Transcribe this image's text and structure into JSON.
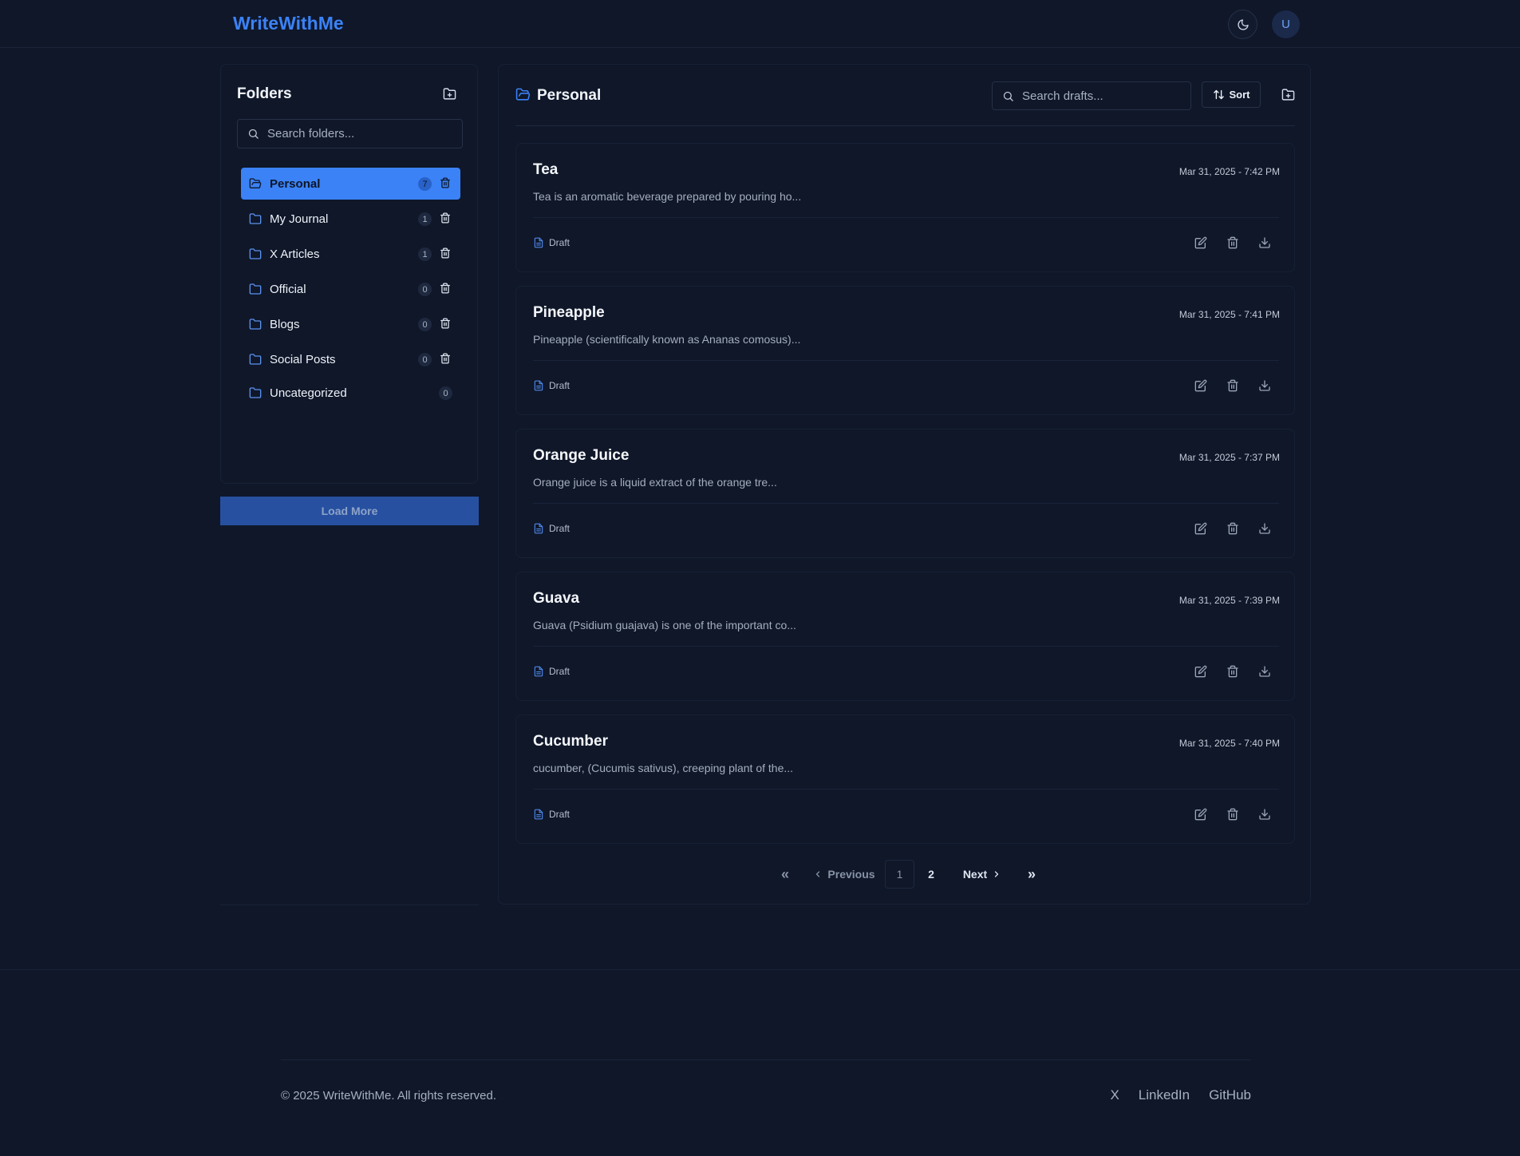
{
  "header": {
    "brand": "WriteWithMe",
    "avatar_initial": "U"
  },
  "sidebar": {
    "title": "Folders",
    "search_placeholder": "Search folders...",
    "folders": [
      {
        "name": "Personal",
        "count": "7",
        "active": true
      },
      {
        "name": "My Journal",
        "count": "1"
      },
      {
        "name": "X Articles",
        "count": "1"
      },
      {
        "name": "Official",
        "count": "0"
      },
      {
        "name": "Blogs",
        "count": "0"
      },
      {
        "name": "Social Posts",
        "count": "0"
      },
      {
        "name": "Uncategorized",
        "count": "0"
      }
    ],
    "load_more_label": "Load More"
  },
  "drafts": {
    "folder_title": "Personal",
    "search_placeholder": "Search drafts...",
    "sort_label": "Sort",
    "items": [
      {
        "title": "Tea",
        "date": "Mar 31, 2025 - 7:42 PM",
        "excerpt": "Tea is an aromatic beverage prepared by pouring ho...",
        "status": "Draft"
      },
      {
        "title": "Pineapple",
        "date": "Mar 31, 2025 - 7:41 PM",
        "excerpt": "Pineapple (scientifically known as Ananas comosus)...",
        "status": "Draft"
      },
      {
        "title": "Orange Juice",
        "date": "Mar 31, 2025 - 7:37 PM",
        "excerpt": "Orange juice is a liquid extract of the orange tre...",
        "status": "Draft"
      },
      {
        "title": "Guava",
        "date": "Mar 31, 2025 - 7:39 PM",
        "excerpt": "Guava (Psidium guajava) is one of the important co...",
        "status": "Draft"
      },
      {
        "title": "Cucumber",
        "date": "Mar 31, 2025 - 7:40 PM",
        "excerpt": "cucumber, (Cucumis sativus), creeping plant of the...",
        "status": "Draft"
      }
    ],
    "pagination": {
      "first": "«",
      "previous": "Previous",
      "pages": [
        "1",
        "2"
      ],
      "current_page": "1",
      "next": "Next",
      "last": "»"
    }
  },
  "footer": {
    "copyright": "© 2025 WriteWithMe. All rights reserved.",
    "links": [
      "X",
      "LinkedIn",
      "GitHub"
    ]
  },
  "colors": {
    "background": "#0f1729",
    "accent": "#3b82f6",
    "load_more": "#2750a0"
  },
  "icons": {
    "theme_toggle": "moon-icon",
    "new_folder": "folder-plus-icon",
    "search": "search-icon",
    "folder": "folder-icon",
    "folder_open": "folder-open-icon",
    "delete": "trash-icon",
    "sort": "arrow-up-down-icon",
    "draft": "file-text-icon",
    "edit": "edit-icon",
    "download": "download-icon"
  }
}
